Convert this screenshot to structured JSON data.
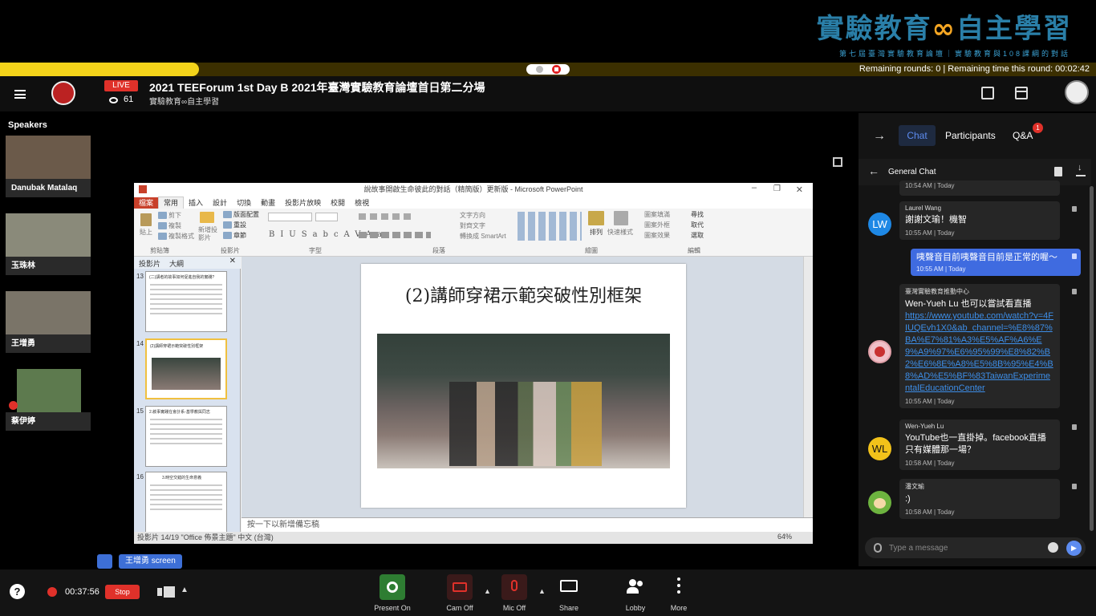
{
  "banner": {
    "logo_left": "實驗教育",
    "logo_symbol": "∞",
    "logo_right": "自主學習",
    "subtitle": "第七屆臺灣實驗教育論壇｜實驗教育與108課綱的對話"
  },
  "rounds": "Remaining rounds: 0 | Remaining time this round: 00:02:42",
  "header": {
    "live": "LIVE",
    "viewers": "61",
    "title": "2021 TEEForum 1st Day B 2021年臺灣實驗教育論壇首日第二分場",
    "subtitle": "實驗教育∞自主學習"
  },
  "speakers": {
    "label": "Speakers",
    "items": [
      {
        "name": "Danubak Matalaq",
        "bg": "#6b5a4a"
      },
      {
        "name": "玉珠林",
        "bg": "#8a8a7a"
      },
      {
        "name": "王增勇",
        "bg": "#7a7468"
      },
      {
        "name": "蔡伊婷",
        "bg": "#5d7a4e"
      }
    ]
  },
  "ppt": {
    "window_title": "說故事開啟生命彼此的對話（精簡版）更新版 - Microsoft PowerPoint",
    "tabs": [
      "檔案",
      "常用",
      "插入",
      "設計",
      "切換",
      "動畫",
      "投影片放映",
      "校閱",
      "檢視"
    ],
    "groups": [
      "剪貼簿",
      "投影片",
      "字型",
      "段落",
      "繪圖",
      "編輯"
    ],
    "ribbon": {
      "paste": "貼上",
      "cut": "剪下",
      "copy": "複製",
      "format_painter": "複製格式",
      "new_slide": "新增投影片",
      "layout": "版面配置",
      "reset": "重設",
      "section": "章節",
      "text_direction": "文字方向",
      "align_text": "對齊文字",
      "smartart": "轉換成 SmartArt",
      "arrange": "排列",
      "quick_styles": "快速樣式",
      "shape_fill": "圖案填滿",
      "shape_outline": "圖案外框",
      "shape_effects": "圖案效果",
      "find": "尋找",
      "replace": "取代",
      "select": "選取"
    },
    "left_tabs": [
      "投影片",
      "大綱"
    ],
    "thumbs": [
      {
        "num": "13",
        "title": "(二)講者的故事如何促進自我的實踐?"
      },
      {
        "num": "14",
        "title": "(2)講師穿裙示範突破性別框架"
      },
      {
        "num": "15",
        "title": "2.敘事實踐在會計系-基學教與同志"
      },
      {
        "num": "16",
        "title": "3.時空交錯的生命意義"
      }
    ],
    "slide_title": "(2)講師穿裙示範突破性別框架",
    "notes_placeholder": "按一下以新增備忘稿",
    "status": "投影片 14/19   \"Office 佈景主題\"   中文 (台灣)",
    "zoom": "64%"
  },
  "screen_tag": "王增勇 screen",
  "panel": {
    "tabs": {
      "chat": "Chat",
      "participants": "Participants",
      "qa": "Q&A",
      "qa_count": "1"
    },
    "chat_title": "General Chat",
    "partial_time": "10:54 AM | Today",
    "messages": [
      {
        "who": "Laurel Wang",
        "initials": "LW",
        "text": "謝謝文瑜！機智",
        "time": "10:55 AM | Today",
        "color": "#1e88e5"
      },
      {
        "who": "",
        "initials": "",
        "text": "咦聲音目前咦聲音目前是正常的喔～",
        "time": "10:55 AM | Today",
        "color": "#3f6be0"
      },
      {
        "who": "臺灣實驗教育推動中心",
        "initials": "",
        "text": "Wen-Yueh Lu 也可以嘗試看直播",
        "link": "https://www.youtube.com/watch?v=4FIUQEvh1X0&ab_channel=%E8%87%BA%E7%81%A3%E5%AF%A6%E9%A9%97%E6%95%99%E8%82%B2%E6%8E%A8%E5%8B%95%E4%B8%AD%E5%BF%83TaiwanExperimentalEducationCenter",
        "time": "10:55 AM | Today",
        "color": "#f0c0c8"
      },
      {
        "who": "Wen-Yueh Lu",
        "initials": "WL",
        "text": "YouTube也一直掛掉。facebook直播只有媒體那一場？",
        "time": "10:58 AM | Today",
        "color": "#f2c21a"
      },
      {
        "who": "潘文瑜",
        "initials": "",
        "text": ":)",
        "time": "10:58 AM | Today",
        "color": "#6db33f"
      }
    ],
    "input_placeholder": "Type a message"
  },
  "bottom": {
    "help": "?",
    "rec_time": "00:37:56",
    "stop": "Stop",
    "controls": [
      {
        "label": "Present On",
        "color": "#2e7d32"
      },
      {
        "label": "Cam Off",
        "color": "#3a1a1a"
      },
      {
        "label": "Mic Off",
        "color": "#3a1a1a"
      },
      {
        "label": "Share",
        "color": "#141414"
      },
      {
        "label": "Lobby",
        "color": "#141414"
      },
      {
        "label": "More",
        "color": "#141414"
      }
    ]
  }
}
